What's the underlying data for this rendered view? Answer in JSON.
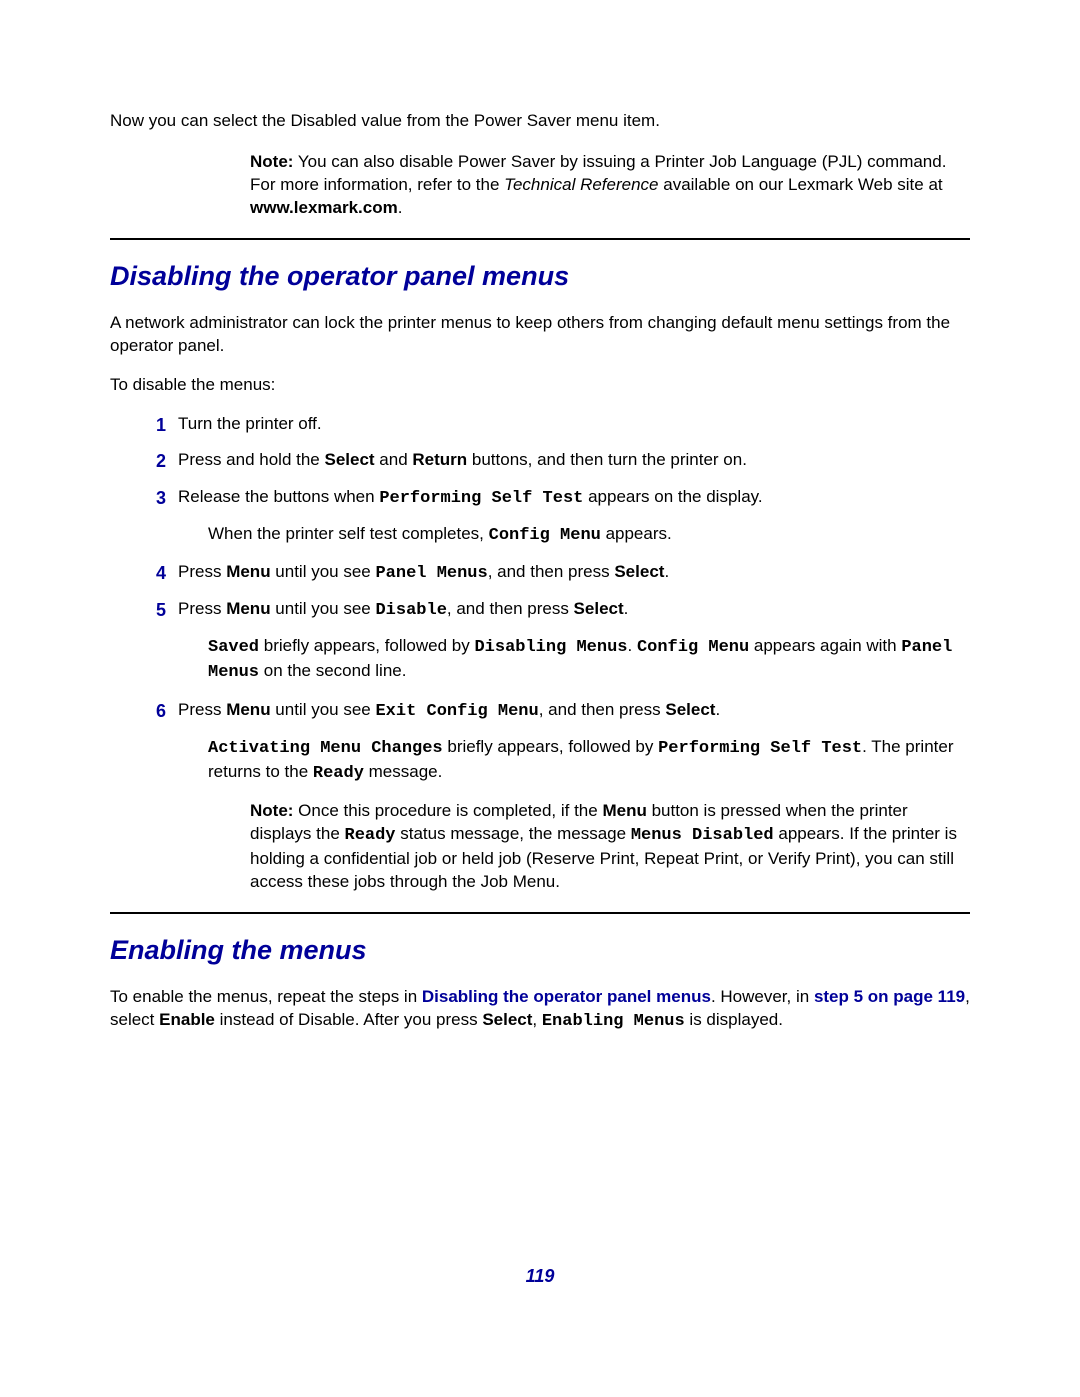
{
  "intro": "Now you can select the Disabled value from the Power Saver menu item.",
  "note1": {
    "label": "Note:",
    "t1": " You can also disable Power Saver by issuing a Printer Job Language (PJL) command. For more information, refer to the ",
    "italic": "Technical Reference",
    "t2": " available on our Lexmark Web site at ",
    "site": "www.lexmark.com",
    "t3": "."
  },
  "section1": {
    "title": "Disabling the operator panel menus",
    "p1": "A network administrator can lock the printer menus to keep others from changing default menu settings from the operator panel.",
    "p2": "To disable the menus:",
    "steps": {
      "n1": "1",
      "t1": "Turn the printer off.",
      "n2": "2",
      "t2a": "Press and hold the ",
      "t2b": "Select",
      "t2c": " and ",
      "t2d": "Return",
      "t2e": " buttons, and then turn the printer on.",
      "n3": "3",
      "t3a": "Release the buttons when ",
      "t3b": "Performing Self Test",
      "t3c": " appears on the display.",
      "sub3a": "When the printer self test completes, ",
      "sub3b": "Config Menu",
      "sub3c": " appears.",
      "n4": "4",
      "t4a": "Press ",
      "t4b": "Menu",
      "t4c": " until you see ",
      "t4d": "Panel Menus",
      "t4e": ", and then press ",
      "t4f": "Select",
      "t4g": ".",
      "n5": "5",
      "t5a": "Press ",
      "t5b": "Menu",
      "t5c": " until you see ",
      "t5d": "Disable",
      "t5e": ", and then press ",
      "t5f": "Select",
      "t5g": ".",
      "sub5a": "Saved",
      "sub5b": " briefly appears, followed by ",
      "sub5c": "Disabling Menus",
      "sub5d": ". ",
      "sub5e": "Config Menu",
      "sub5f": " appears again with ",
      "sub5g": "Panel Menus",
      "sub5h": " on the second line.",
      "n6": "6",
      "t6a": "Press ",
      "t6b": "Menu",
      "t6c": " until you see ",
      "t6d": "Exit Config Menu",
      "t6e": ", and then press ",
      "t6f": "Select",
      "t6g": ".",
      "sub6a": "Activating Menu Changes",
      "sub6b": " briefly appears, followed by ",
      "sub6c": "Performing Self Test",
      "sub6d": ". The printer returns to the ",
      "sub6e": "Ready",
      "sub6f": " message."
    },
    "note2": {
      "label": "Note:",
      "a": " Once this procedure is completed, if the ",
      "b": "Menu",
      "c": " button is pressed when the printer displays the ",
      "d": "Ready",
      "e": "  status message, the message ",
      "f": "Menus Disabled",
      "g": " appears. If the printer is holding a confidential job or held job (Reserve Print, Repeat Print, or Verify Print), you can still access these jobs through the Job Menu."
    }
  },
  "section2": {
    "title": "Enabling the menus",
    "p1a": "To enable the menus, repeat the steps in ",
    "link1": "Disabling the operator panel menus",
    "p1b": ". However, in ",
    "link2": "step 5 on page 119",
    "p1c": ", select ",
    "b1": "Enable",
    "p1d": " instead of Disable. After you press ",
    "b2": "Select",
    "p1e": ", ",
    "m1": "Enabling Menus",
    "p1f": " is displayed."
  },
  "pageNum": "119"
}
